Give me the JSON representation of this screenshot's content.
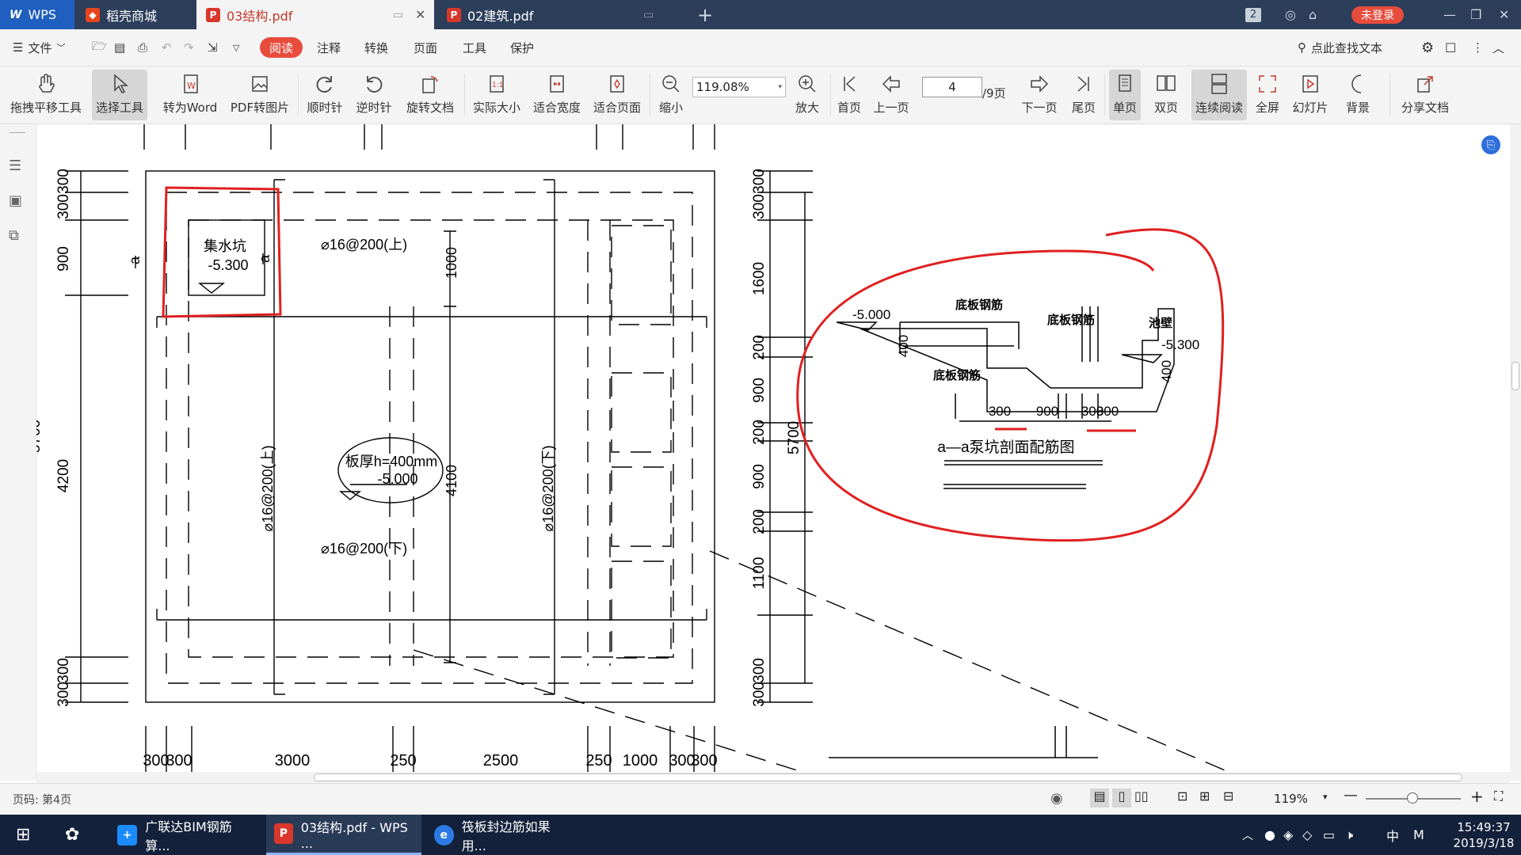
{
  "titlebar": {
    "logo": "WPS",
    "tabs": [
      {
        "label": "稻壳商城"
      },
      {
        "label": "03结构.pdf"
      },
      {
        "label": "02建筑.pdf"
      }
    ],
    "window_count": "2",
    "login_label": "未登录"
  },
  "menubar": {
    "file_label": "文件",
    "items": [
      "阅读",
      "注释",
      "转换",
      "页面",
      "工具",
      "保护"
    ],
    "search_label": "点此查找文本"
  },
  "ribbon": {
    "buttons": [
      "拖拽平移工具",
      "选择工具",
      "转为Word",
      "PDF转图片",
      "顺时针",
      "逆时针",
      "旋转文档",
      "实际大小",
      "适合宽度",
      "适合页面",
      "缩小",
      "放大",
      "首页",
      "上一页",
      "下一页",
      "尾页",
      "单页",
      "双页",
      "连续阅读",
      "全屏",
      "幻灯片",
      "背景",
      "分享文档"
    ],
    "zoom_value": "119.08%",
    "page_current": "4",
    "page_total": "/9页"
  },
  "drawing": {
    "pit_label": "集水坑",
    "pit_level": "-5.300",
    "slab_label": "板厚h=400mm",
    "slab_level": "-5.000",
    "rebar_top_h": "⌀16@200(上)",
    "rebar_bottom_h": "⌀16@200(下)",
    "rebar_top_v": "⌀16@200(上)",
    "rebar_bottom_v": "⌀16@200(下)",
    "section_mark": "a",
    "dim_bottom": [
      "300",
      "300",
      "3000",
      "250",
      "2500",
      "250",
      "1000",
      "300",
      "300"
    ],
    "dim_left": [
      "300",
      "300",
      "900",
      "4200",
      "300",
      "300"
    ],
    "dim_left_total": "5700",
    "dim_right": [
      "300",
      "300",
      "1600",
      "200",
      "900",
      "200",
      "900",
      "200",
      "1100",
      "300",
      "300"
    ],
    "dim_right_total": "5700",
    "dim_inner": [
      "1000",
      "4100"
    ],
    "section": {
      "title": "a—a泵坑剖面配筋图",
      "label_left_level": "-5.000",
      "label_right_level": "-5.300",
      "rebar_labels": [
        "底板钢筋",
        "底板钢筋",
        "底板钢筋",
        "池壁"
      ],
      "dims": [
        "300",
        "900",
        "300",
        "300"
      ],
      "thickness": [
        "400",
        "400"
      ]
    }
  },
  "statusbar": {
    "page_label": "页码: 第4页",
    "zoom": "119%"
  },
  "taskbar": {
    "apps": [
      "广联达BIM钢筋算...",
      "03结构.pdf - WPS ...",
      "筏板封边筋如果用..."
    ],
    "ime": "中",
    "ime2": "M",
    "time": "15:49:37",
    "date": "2019/3/18"
  }
}
